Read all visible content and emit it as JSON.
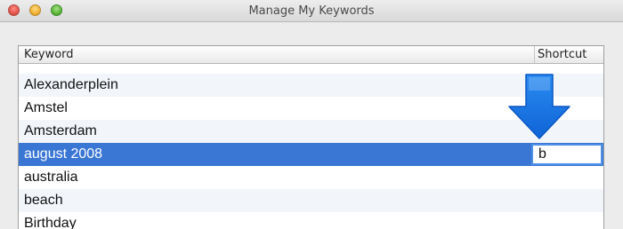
{
  "window": {
    "title": "Manage My Keywords",
    "controls": {
      "close_glyph": "",
      "minimize_glyph": "",
      "maximize_glyph": ""
    }
  },
  "table": {
    "columns": {
      "keyword": "Keyword",
      "shortcut": "Shortcut"
    },
    "rows": [
      {
        "keyword": "",
        "shortcut": ""
      },
      {
        "keyword": "Alexanderplein",
        "shortcut": ""
      },
      {
        "keyword": "Amstel",
        "shortcut": ""
      },
      {
        "keyword": "Amsterdam",
        "shortcut": ""
      },
      {
        "keyword": "august 2008",
        "shortcut": "b"
      },
      {
        "keyword": "australia",
        "shortcut": ""
      },
      {
        "keyword": "beach",
        "shortcut": ""
      },
      {
        "keyword": "Birthday",
        "shortcut": ""
      }
    ],
    "selected_row_index": 4
  },
  "annotation": {
    "icon": "down-arrow-icon",
    "color": "#1f7fe8"
  },
  "colors": {
    "selection": "#3a76d3",
    "focus_ring": "#4d90e6"
  }
}
